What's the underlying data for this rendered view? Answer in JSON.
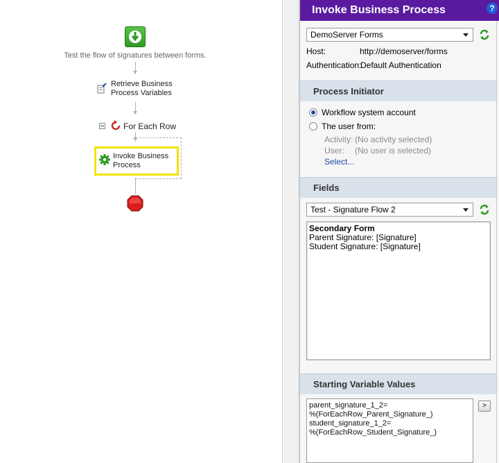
{
  "workflow": {
    "caption": "Test the flow of signatures between forms.",
    "nodes": {
      "retrieve_line1": "Retrieve Business",
      "retrieve_line2": "Process Variables",
      "for_each": "For Each Row",
      "invoke_line1": "Invoke Business",
      "invoke_line2": "Process"
    },
    "highlight_color": "#f2e300"
  },
  "panel": {
    "title": "Invoke Business Process",
    "help": "?",
    "header_color": "#5a1aa0",
    "server_select": "DemoServer Forms",
    "host_label": "Host:",
    "host_value": "http://demoserver/forms",
    "auth_label": "Authentication:",
    "auth_value": "Default Authentication",
    "initiator": {
      "heading": "Process Initiator",
      "option1": "Workflow system account",
      "option2": "The user from:",
      "activity_label": "Activity:",
      "activity_value": "(No activity selected)",
      "user_label": "User:",
      "user_value": "(No user is selected)",
      "select_link": "Select..."
    },
    "fields": {
      "heading": "Fields",
      "form_select": "Test - Signature Flow 2",
      "box_title": "Secondary Form",
      "line1": "Parent Signature: [Signature]",
      "line2": "Student Signature: [Signature]"
    },
    "variables": {
      "heading": "Starting Variable Values",
      "line1": "parent_signature_1_2=",
      "line2": "%(ForEachRow_Parent_Signature_)",
      "line3": "student_signature_1_2=",
      "line4": "%(ForEachRow_Student_Signature_)",
      "button": ">"
    }
  }
}
